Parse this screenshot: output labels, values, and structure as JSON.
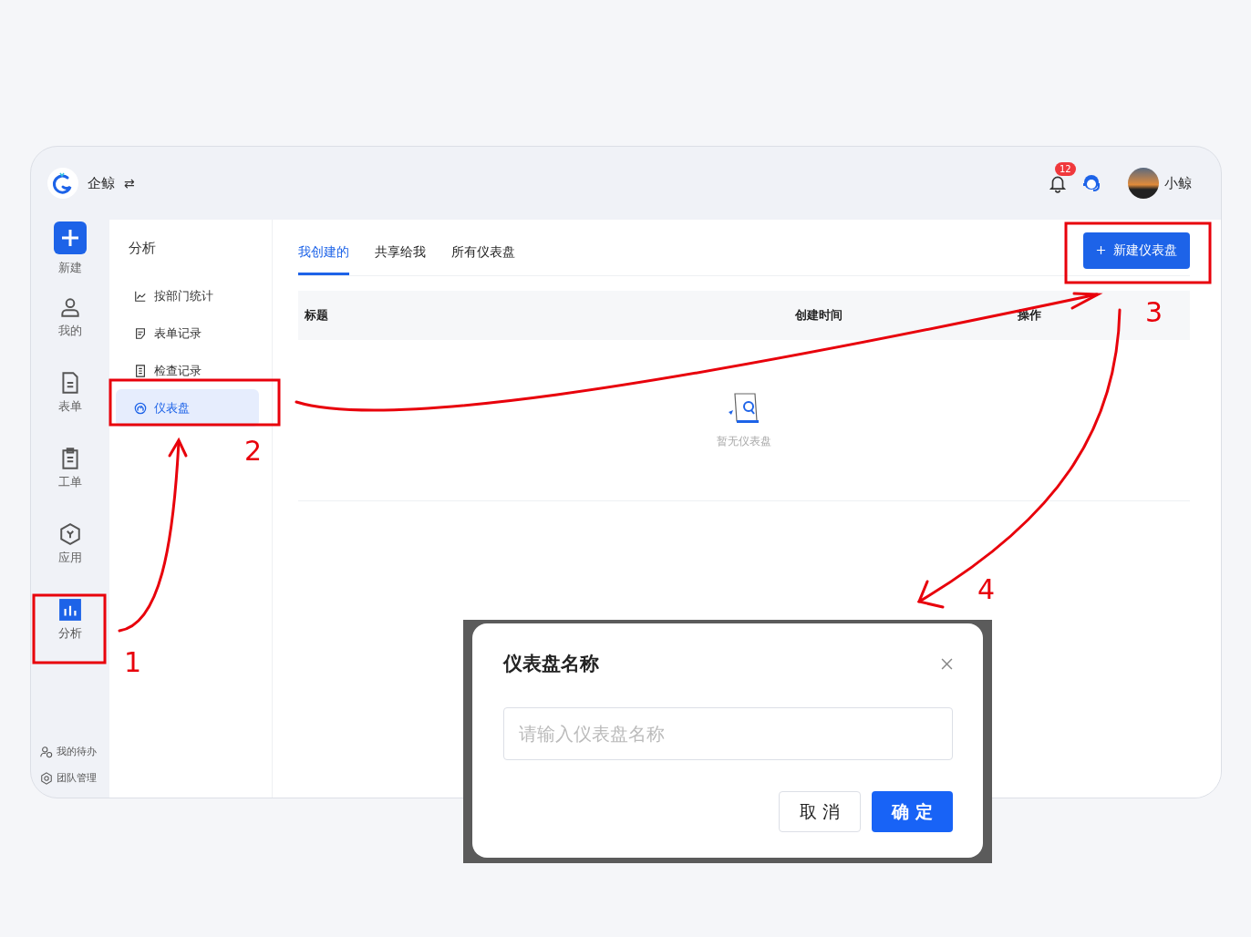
{
  "header": {
    "brand": "企鲸",
    "switch_glyph": "⇄",
    "notifications": "12",
    "user": "小鲸"
  },
  "rail": {
    "items": [
      {
        "kind": "create",
        "label": "新建",
        "selected": false
      },
      {
        "kind": "user",
        "label": "我的",
        "selected": false
      },
      {
        "kind": "form",
        "label": "表单",
        "selected": false
      },
      {
        "kind": "clipboard",
        "label": "工单",
        "selected": false
      },
      {
        "kind": "app",
        "label": "应用",
        "selected": false
      },
      {
        "kind": "chart",
        "label": "分析",
        "selected": true
      }
    ],
    "footer": [
      {
        "kind": "todo",
        "label": "我的待办"
      },
      {
        "kind": "team",
        "label": "团队管理"
      }
    ]
  },
  "submenu": {
    "title": "分析",
    "items": [
      {
        "kind": "trend",
        "label": "按部门统计",
        "selected": false
      },
      {
        "kind": "form",
        "label": "表单记录",
        "selected": false
      },
      {
        "kind": "doc",
        "label": "检查记录",
        "selected": false
      },
      {
        "kind": "gauge",
        "label": "仪表盘",
        "selected": true
      }
    ]
  },
  "tabs": [
    {
      "label": "我创建的",
      "selected": true
    },
    {
      "label": "共享给我",
      "selected": false
    },
    {
      "label": "所有仪表盘",
      "selected": false
    }
  ],
  "new_button": "新建仪表盘",
  "table": {
    "columns": [
      "标题",
      "创建时间",
      "操作"
    ],
    "empty_text": "暂无仪表盘"
  },
  "dialog": {
    "title": "仪表盘名称",
    "placeholder": "请输入仪表盘名称",
    "cancel": "取 消",
    "confirm": "确 定"
  },
  "callouts": [
    {
      "label": "1"
    },
    {
      "label": "2"
    },
    {
      "label": "3"
    },
    {
      "label": "4"
    }
  ]
}
